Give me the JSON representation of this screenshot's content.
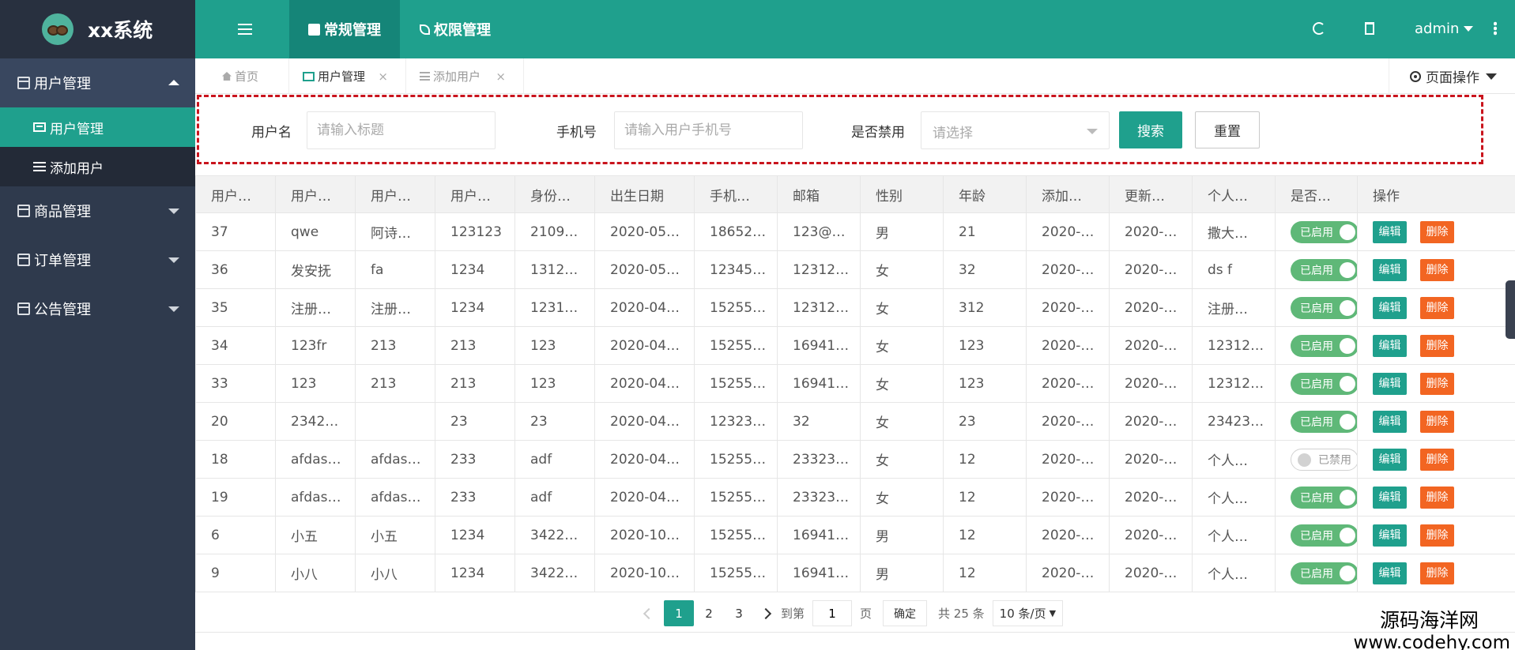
{
  "app": {
    "title": "xx系统"
  },
  "sidebar": {
    "groups": [
      {
        "label": "用户管理",
        "open": true,
        "items": [
          {
            "label": "用户管理",
            "active": true
          },
          {
            "label": "添加用户",
            "active": false
          }
        ]
      },
      {
        "label": "商品管理",
        "open": false
      },
      {
        "label": "订单管理",
        "open": false
      },
      {
        "label": "公告管理",
        "open": false
      }
    ]
  },
  "header": {
    "tabs": [
      {
        "label": "常规管理",
        "active": true
      },
      {
        "label": "权限管理",
        "active": false
      }
    ],
    "user": "admin",
    "icons": [
      "menu-icon",
      "refresh-icon",
      "trash-icon",
      "more-icon"
    ]
  },
  "tabbar": {
    "tabs": [
      {
        "label": "首页",
        "icon": "home-icon",
        "closable": false
      },
      {
        "label": "用户管理",
        "icon": "card-icon",
        "closable": true,
        "active": true
      },
      {
        "label": "添加用户",
        "icon": "list-icon",
        "closable": true
      }
    ],
    "close_glyph": "×",
    "page_ops_label": "页面操作"
  },
  "search": {
    "username_label": "用户名",
    "username_placeholder": "请输入标题",
    "phone_label": "手机号",
    "phone_placeholder": "请输入用户手机号",
    "disabled_label": "是否禁用",
    "disabled_placeholder": "请选择",
    "search_btn": "搜索",
    "reset_btn": "重置"
  },
  "table": {
    "headers": [
      "用户…",
      "用户…",
      "用户…",
      "用户…",
      "身份…",
      "出生日期",
      "手机…",
      "邮箱",
      "性别",
      "年龄",
      "添加…",
      "更新…",
      "个人…",
      "是否…",
      "操作"
    ],
    "rows": [
      {
        "cells": [
          "37",
          "qwe",
          "阿诗…",
          "123123",
          "2109…",
          "2020-05…",
          "18652…",
          "123@…",
          "男",
          "21",
          "2020-…",
          "2020-…",
          "撒大…"
        ],
        "enabled": true
      },
      {
        "cells": [
          "36",
          "发安抚",
          "fa",
          "1234",
          "1312…",
          "2020-05…",
          "12345…",
          "12312…",
          "女",
          "32",
          "2020-…",
          "2020-…",
          "ds f"
        ],
        "enabled": true
      },
      {
        "cells": [
          "35",
          "注册…",
          "注册…",
          "1234",
          "1231…",
          "2020-04…",
          "15255…",
          "12312…",
          "女",
          "312",
          "2020-…",
          "2020-…",
          "注册…"
        ],
        "enabled": true
      },
      {
        "cells": [
          "34",
          "123fr",
          "213",
          "213",
          "123",
          "2020-04…",
          "15255…",
          "16941…",
          "女",
          "123",
          "2020-…",
          "2020-…",
          "12312…"
        ],
        "enabled": true
      },
      {
        "cells": [
          "33",
          "123",
          "213",
          "213",
          "123",
          "2020-04…",
          "15255…",
          "16941…",
          "女",
          "123",
          "2020-…",
          "2020-…",
          "12312…"
        ],
        "enabled": true
      },
      {
        "cells": [
          "20",
          "2342…",
          "",
          "23",
          "23",
          "2020-04…",
          "12323…",
          "32",
          "女",
          "23",
          "2020-…",
          "2020-…",
          "23423…"
        ],
        "enabled": true
      },
      {
        "cells": [
          "18",
          "afdas…",
          "afdas…",
          "233",
          "adf",
          "2020-04…",
          "15255…",
          "23323…",
          "女",
          "12",
          "2020-…",
          "2020-…",
          "个人…"
        ],
        "enabled": false
      },
      {
        "cells": [
          "19",
          "afdas…",
          "afdas…",
          "233",
          "adf",
          "2020-04…",
          "15255…",
          "23323…",
          "女",
          "12",
          "2020-…",
          "2020-…",
          "个人…"
        ],
        "enabled": true
      },
      {
        "cells": [
          "6",
          "小五",
          "小五",
          "1234",
          "3422…",
          "2020-10…",
          "15255…",
          "16941…",
          "男",
          "12",
          "2020-…",
          "2020-…",
          "个人…"
        ],
        "enabled": true
      },
      {
        "cells": [
          "9",
          "小八",
          "小八",
          "1234",
          "3422…",
          "2020-10…",
          "15255…",
          "16941…",
          "男",
          "12",
          "2020-…",
          "2020-…",
          "个人…"
        ],
        "enabled": true
      }
    ],
    "toggle_on_label": "已启用",
    "toggle_off_label": "已禁用",
    "edit_label": "编辑",
    "delete_label": "删除"
  },
  "pagination": {
    "pages": [
      "1",
      "2",
      "3"
    ],
    "current": "1",
    "goto_label": "到第",
    "goto_value": "1",
    "page_unit": "页",
    "confirm": "确定",
    "total": "共 25 条",
    "page_size": "10 条/页"
  },
  "watermark": {
    "name": "源码海洋网",
    "url": "www.codehy.com"
  },
  "colors": {
    "accent": "#1fa08d",
    "sidebar": "#2f3a4d",
    "danger": "#f26522",
    "toggle_on": "#5fb878",
    "highlight_border": "#c9141d"
  }
}
